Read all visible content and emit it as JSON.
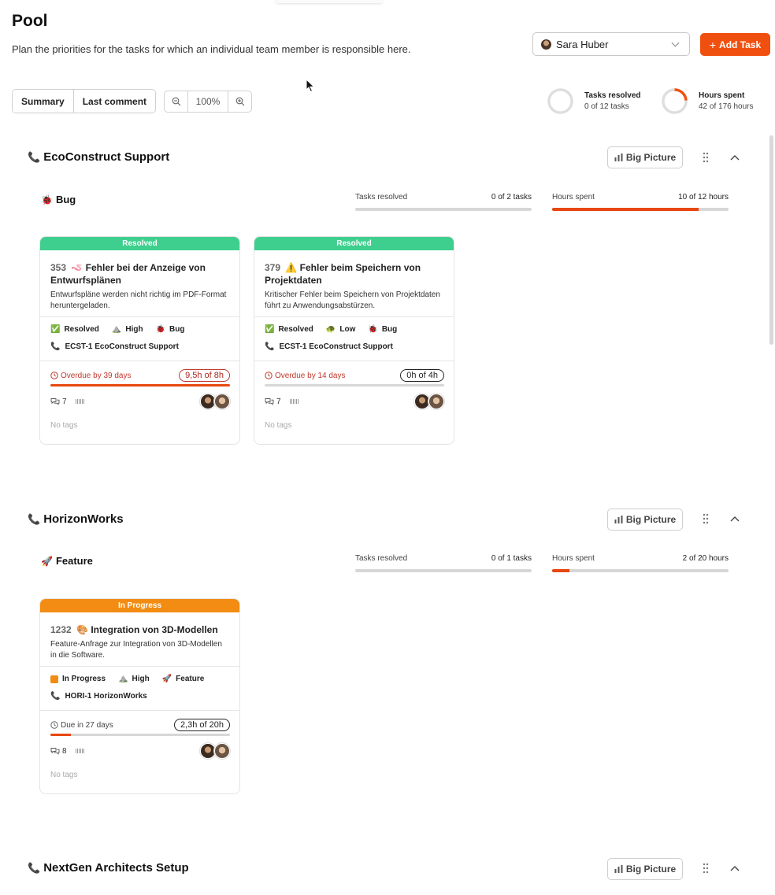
{
  "page": {
    "title": "Pool",
    "subtitle": "Plan the priorities for the tasks for which an individual team member is responsible here."
  },
  "user_select": {
    "selected": "Sara Huber"
  },
  "add_task_label": "Add Task",
  "view_tabs": [
    "Summary",
    "Last comment"
  ],
  "zoom": {
    "value": "100%"
  },
  "stats": {
    "tasks": {
      "label": "Tasks resolved",
      "value": "0 of 12 tasks",
      "fraction": 0.0
    },
    "hours": {
      "label": "Hours spent",
      "value": "42 of 176 hours",
      "fraction": 0.24
    }
  },
  "big_picture_label": "Big Picture",
  "colors": {
    "accent": "#f0500f",
    "resolved": "#3ecf8e",
    "in_progress": "#f28c12",
    "overdue": "#c0392b"
  },
  "projects": [
    {
      "name": "EcoConstruct Support",
      "icon": "phone-icon",
      "type": {
        "name": "Bug",
        "icon": "bug-icon",
        "tasks_label": "Tasks resolved",
        "tasks_value": "0 of 2 tasks",
        "tasks_fraction": 0.0,
        "hours_label": "Hours spent",
        "hours_value": "10 of 12 hours",
        "hours_fraction": 0.83
      },
      "cards": [
        {
          "status": "Resolved",
          "id": "353",
          "title_icon": "worm-icon",
          "title": "Fehler bei der Anzeige von Entwurfsplänen",
          "desc": "Entwurfspläne werden nicht richtig im PDF-Format heruntergeladen.",
          "state": "Resolved",
          "priority": "High",
          "type": "Bug",
          "project": "ECST-1 EcoConstruct Support",
          "due": "Overdue by 39 days",
          "overdue": true,
          "hours": "9,5h of 8h",
          "progress": 1.0,
          "comments": "7",
          "tags": "No tags"
        },
        {
          "status": "Resolved",
          "id": "379",
          "title_icon": "warning-icon",
          "title": "Fehler beim Speichern von Projektdaten",
          "desc": "Kritischer Fehler beim Speichern von Projektdaten führt zu Anwendungsabstürzen.",
          "state": "Resolved",
          "priority": "Low",
          "type": "Bug",
          "project": "ECST-1 EcoConstruct Support",
          "due": "Overdue by 14 days",
          "overdue": true,
          "hours": "0h of 4h",
          "progress": 0.0,
          "comments": "7",
          "tags": "No tags"
        }
      ]
    },
    {
      "name": "HorizonWorks",
      "icon": "phone-icon",
      "type": {
        "name": "Feature",
        "icon": "rocket-icon",
        "tasks_label": "Tasks resolved",
        "tasks_value": "0 of 1 tasks",
        "tasks_fraction": 0.0,
        "hours_label": "Hours spent",
        "hours_value": "2 of 20 hours",
        "hours_fraction": 0.1
      },
      "cards": [
        {
          "status": "In Progress",
          "id": "1232",
          "title_icon": "palette-icon",
          "title": "Integration von 3D-Modellen",
          "desc": "Feature-Anfrage zur Integration von 3D-Modellen in die Software.",
          "state": "In Progress",
          "priority": "High",
          "type": "Feature",
          "project": "HORI-1 HorizonWorks",
          "due": "Due in 27 days",
          "overdue": false,
          "hours": "2,3h of 20h",
          "progress": 0.115,
          "comments": "8",
          "tags": "No tags"
        }
      ]
    },
    {
      "name": "NextGen Architects Setup",
      "icon": "phone-icon"
    }
  ]
}
